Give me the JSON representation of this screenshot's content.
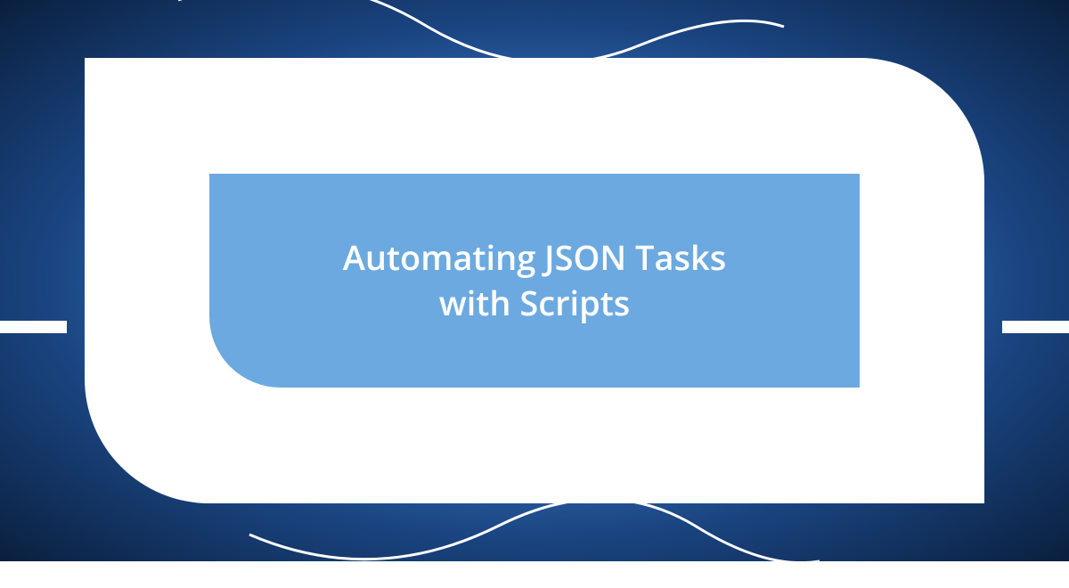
{
  "title": {
    "line1": "Automating JSON Tasks",
    "line2": "with Scripts"
  },
  "colors": {
    "background_dark": "#0a1f3d",
    "background_mid": "#1a4480",
    "background_light": "#5b9bd5",
    "inner_panel": "#6ca9e0",
    "outer_panel": "#ffffff",
    "text": "#ffffff"
  }
}
